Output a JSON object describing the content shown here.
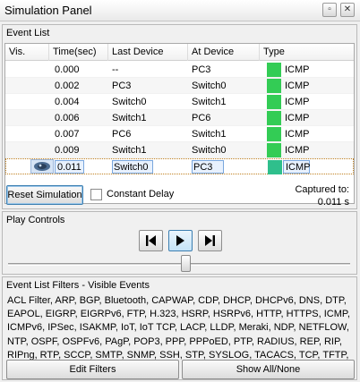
{
  "window": {
    "title": "Simulation Panel",
    "restore_glyph": "▫",
    "close_glyph": "✕"
  },
  "event_list": {
    "label": "Event List",
    "columns": [
      "Vis.",
      "Time(sec)",
      "Last Device",
      "At Device",
      "Type"
    ],
    "rows": [
      {
        "time": "0.000",
        "last": "--",
        "at": "PC3",
        "type": "ICMP",
        "color": "#33cc55"
      },
      {
        "time": "0.002",
        "last": "PC3",
        "at": "Switch0",
        "type": "ICMP",
        "color": "#33cc55"
      },
      {
        "time": "0.004",
        "last": "Switch0",
        "at": "Switch1",
        "type": "ICMP",
        "color": "#33cc55"
      },
      {
        "time": "0.006",
        "last": "Switch1",
        "at": "PC6",
        "type": "ICMP",
        "color": "#33cc55"
      },
      {
        "time": "0.007",
        "last": "PC6",
        "at": "Switch1",
        "type": "ICMP",
        "color": "#33cc55"
      },
      {
        "time": "0.009",
        "last": "Switch1",
        "at": "Switch0",
        "type": "ICMP",
        "color": "#33cc55"
      },
      {
        "time": "0.011",
        "last": "Switch0",
        "at": "PC3",
        "type": "ICMP",
        "color": "#2fbf8c"
      }
    ],
    "reset_button": "Reset Simulation",
    "constant_delay_label": "Constant Delay",
    "captured_label": "Captured to:",
    "captured_value": "0.011 s"
  },
  "play_controls": {
    "label": "Play Controls",
    "back_icon": "step-back-icon",
    "play_icon": "play-icon",
    "forward_icon": "step-forward-icon"
  },
  "filters": {
    "label": "Event List Filters - Visible Events",
    "events": "ACL Filter, ARP, BGP, Bluetooth, CAPWAP, CDP, DHCP, DHCPv6, DNS, DTP, EAPOL, EIGRP, EIGRPv6, FTP, H.323, HSRP, HSRPv6, HTTP, HTTPS, ICMP, ICMPv6, IPSec, ISAKMP, IoT, IoT TCP, LACP, LLDP, Meraki, NDP, NETFLOW, NTP, OSPF, OSPFv6, PAgP, POP3, PPP, PPPoED, PTP, RADIUS, REP, RIP, RIPng, RTP, SCCP, SMTP, SNMP, SSH, STP, SYSLOG, TACACS, TCP, TFTP, Telnet, UDP, USB, VTP",
    "edit_button": "Edit Filters",
    "show_all_button": "Show All/None"
  }
}
